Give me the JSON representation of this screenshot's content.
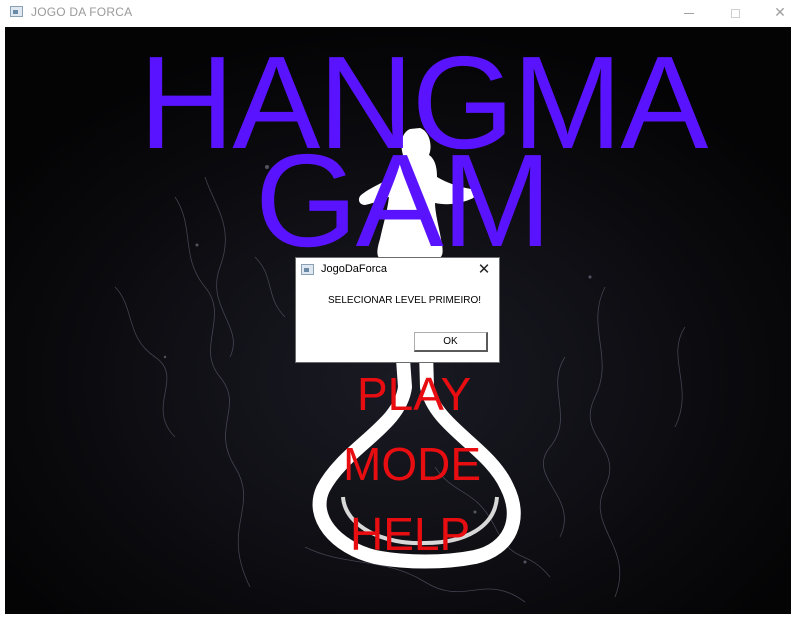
{
  "window": {
    "title": "JOGO DA FORCA",
    "app_icon": "window-app-icon",
    "controls": {
      "minimize_icon": "minimize-icon",
      "maximize_icon": "maximize-icon",
      "close_icon": "close-icon",
      "close_glyph": "✕"
    }
  },
  "game": {
    "title_line_1": "HANGMA",
    "title_line_2": "GAM",
    "title_color": "#5a13ff",
    "menu_color": "#e80d10",
    "menu": {
      "play": "PLAY",
      "mode": "MODE",
      "help": "HELP"
    }
  },
  "dialog": {
    "title": "JogoDaForca",
    "message": "SELECIONAR LEVEL PRIMEIRO!",
    "ok_label": "OK",
    "close_glyph": "✕",
    "icon": "dialog-app-icon"
  }
}
